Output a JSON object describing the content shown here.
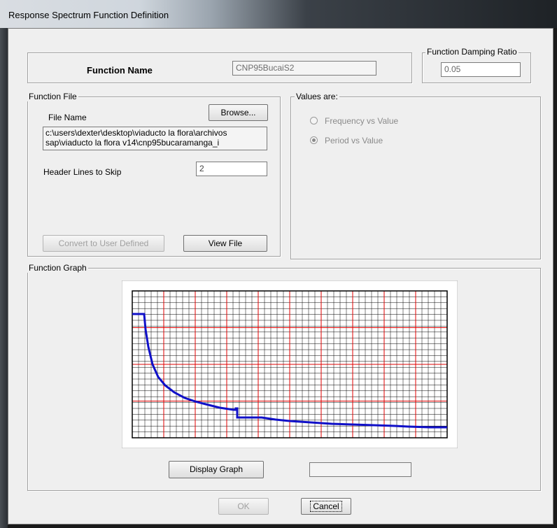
{
  "window": {
    "title": "Response Spectrum  Function Definition"
  },
  "function_name": {
    "label": "Function Name",
    "value": "CNP95BucaiS2"
  },
  "damping": {
    "group_label": "Function Damping Ratio",
    "value": "0.05"
  },
  "function_file": {
    "group_label": "Function File",
    "file_name_label": "File Name",
    "browse_label": "Browse...",
    "path_line1": "c:\\users\\dexter\\desktop\\viaducto la flora\\archivos",
    "path_line2": "sap\\viaducto la flora v14\\cnp95bucaramanga_i",
    "header_lines_label": "Header Lines to Skip",
    "header_lines_value": "2",
    "convert_label": "Convert to User Defined",
    "view_file_label": "View File"
  },
  "values_are": {
    "group_label": "Values are:",
    "options": [
      {
        "label": "Frequency vs Value",
        "selected": false
      },
      {
        "label": "Period vs Value",
        "selected": true
      }
    ]
  },
  "graph": {
    "group_label": "Function Graph",
    "display_label": "Display Graph",
    "readout": "",
    "line_color": "#1010c8"
  },
  "footer": {
    "ok_label": "OK",
    "cancel_label": "Cancel"
  }
}
